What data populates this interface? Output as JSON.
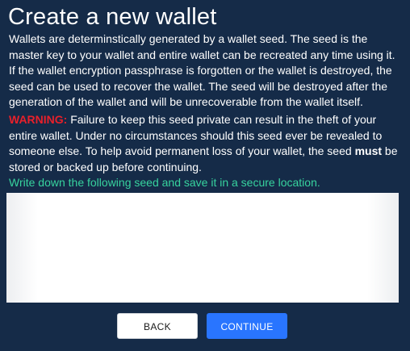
{
  "page": {
    "title": "Create a new wallet"
  },
  "intro": {
    "text": "Wallets are determinstically generated by a wallet seed. The seed is the master key to your wallet and entire wallet can be recreated any time using it. If the wallet encryption passphrase is forgotten or the wallet is destroyed, the seed can be used to recover the wallet. The seed will be destroyed after the generation of the wallet and will be unrecoverable from the wallet itself."
  },
  "warning": {
    "label": "WARNING:",
    "text_before": " Failure to keep this seed private can result in the theft of your entire wallet. Under no circumstances should this seed ever be revealed to someone else. To help avoid permanent loss of your wallet, the seed ",
    "emphasis": "must",
    "text_after": " be stored or backed up before continuing."
  },
  "instruction": {
    "text": "Write down the following seed and save it in a secure location."
  },
  "seed": {
    "text": ""
  },
  "buttons": {
    "back_label": "BACK",
    "continue_label": "CONTINUE"
  },
  "colors": {
    "background": "#152b48",
    "warning": "#e8202a",
    "instruction": "#37d39e",
    "primary_button": "#2975ff",
    "secondary_button": "#ffffff"
  }
}
